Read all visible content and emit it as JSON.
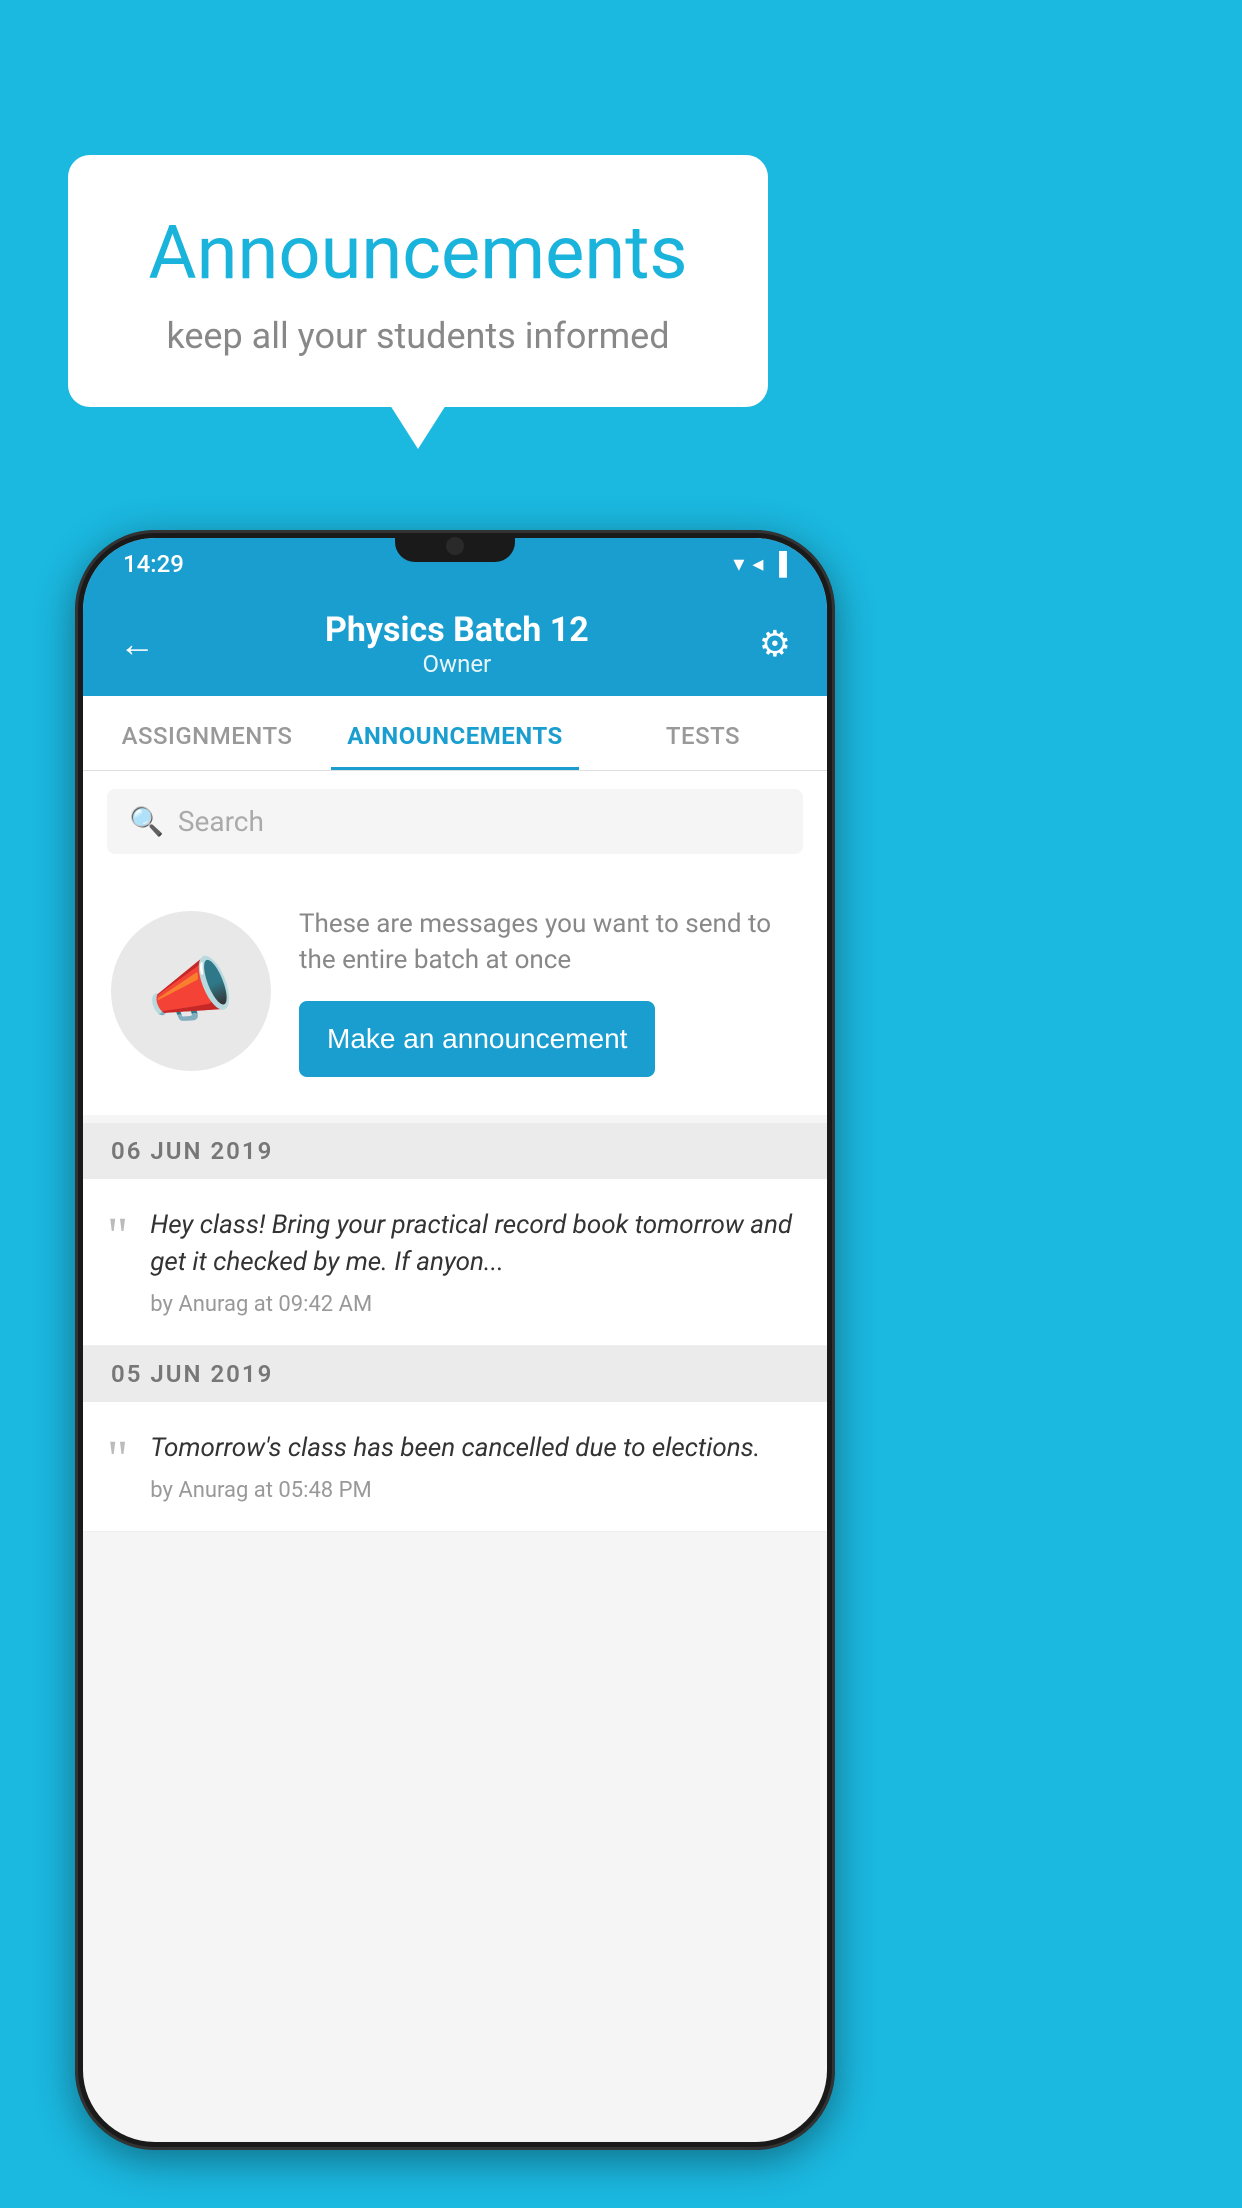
{
  "background_color": "#1bb8e0",
  "speech_bubble": {
    "title": "Announcements",
    "subtitle": "keep all your students informed"
  },
  "phone": {
    "status_bar": {
      "time": "14:29",
      "icons": "▼◀▐"
    },
    "header": {
      "title": "Physics Batch 12",
      "subtitle": "Owner",
      "back_label": "←",
      "gear_label": "⚙"
    },
    "tabs": [
      {
        "label": "ASSIGNMENTS",
        "active": false
      },
      {
        "label": "ANNOUNCEMENTS",
        "active": true
      },
      {
        "label": "TESTS",
        "active": false
      },
      {
        "label": "...",
        "active": false
      }
    ],
    "search": {
      "placeholder": "Search"
    },
    "promo": {
      "description_text": "These are messages you want to send to the entire batch at once",
      "button_label": "Make an announcement"
    },
    "announcement_groups": [
      {
        "date_label": "06  JUN  2019",
        "items": [
          {
            "text": "Hey class! Bring your practical record book tomorrow and get it checked by me. If anyon...",
            "meta": "by Anurag at 09:42 AM"
          }
        ]
      },
      {
        "date_label": "05  JUN  2019",
        "items": [
          {
            "text": "Tomorrow's class has been cancelled due to elections.",
            "meta": "by Anurag at 05:48 PM"
          }
        ]
      }
    ]
  }
}
